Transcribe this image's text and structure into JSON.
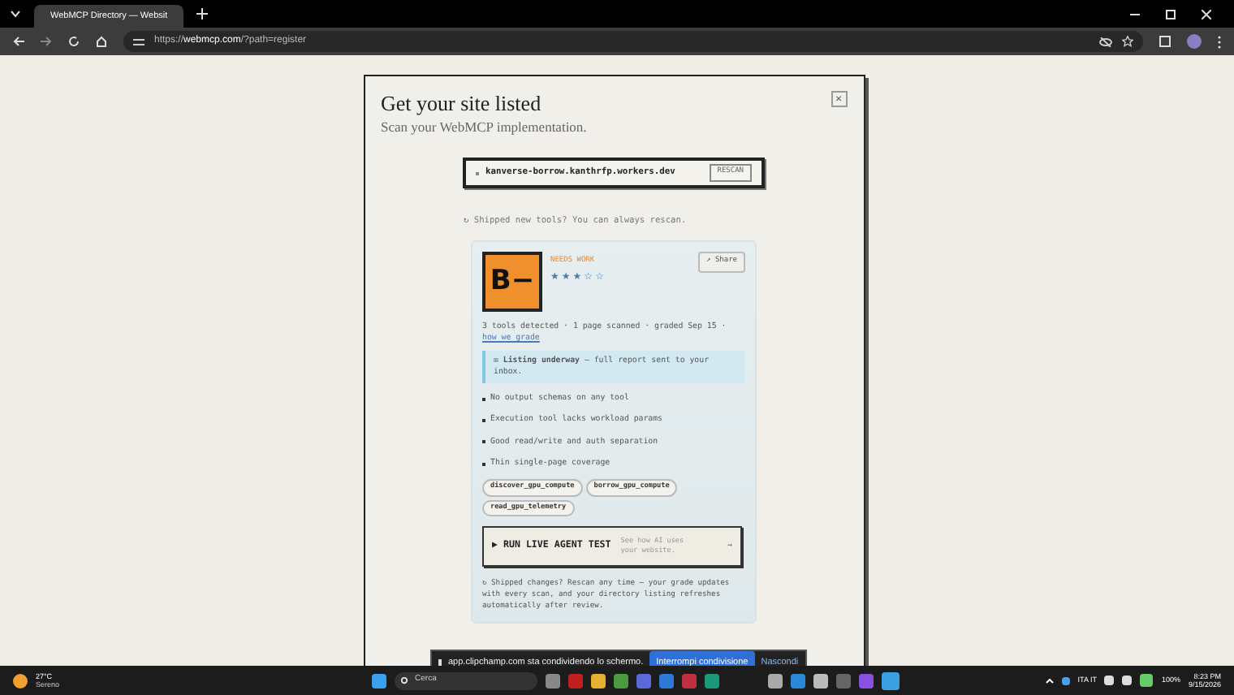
{
  "browser": {
    "tab_title": "WebMCP Directory — Websit",
    "url_prefix": "https://",
    "url_host": "webmcp.com",
    "url_path": "/?path=register"
  },
  "modal": {
    "title": "Get your site listed",
    "subtitle": "Scan your WebMCP implementation.",
    "close": "×",
    "scan": {
      "value": "kanverse-borrow.kanthrfp.workers.dev",
      "button": "RESCAN"
    },
    "hint": "↻ Shipped new tools? You can always rescan.",
    "report": {
      "grade": "B−",
      "verdict": "NEEDS WORK",
      "stars": 3,
      "share": "↗ Share",
      "meta": "3 tools detected · 1 page scanned · graded Sep 15 ·",
      "meta_link": "how we grade",
      "notice": "✉ **Listing underway** — full report sent to your inbox.",
      "findings": [
        "No output schemas on any tool",
        "Execution tool lacks workload params",
        "Good read/write and auth separation",
        "Thin single-page coverage"
      ],
      "tools": [
        "discover_gpu_compute",
        "borrow_gpu_compute",
        "read_gpu_telemetry"
      ],
      "test_button": {
        "label": "▶ RUN LIVE AGENT TEST",
        "note": "See how AI uses your website.",
        "arrow": "→"
      },
      "footer": "↻ Shipped changes? Rescan any time — your grade updates with every scan, and your directory listing refreshes automatically after review."
    }
  },
  "share_bar": {
    "message": "app.clipchamp.com sta condividendo lo schermo.",
    "stop": "Interrompi condivisione",
    "hide": "Nascondi"
  },
  "taskbar": {
    "temperature": "27°C",
    "weather": "Sereno",
    "search": "Cerca",
    "language": "ITA IT",
    "battery": "100%",
    "time": "8:23 PM",
    "date": "9/15/2026"
  }
}
